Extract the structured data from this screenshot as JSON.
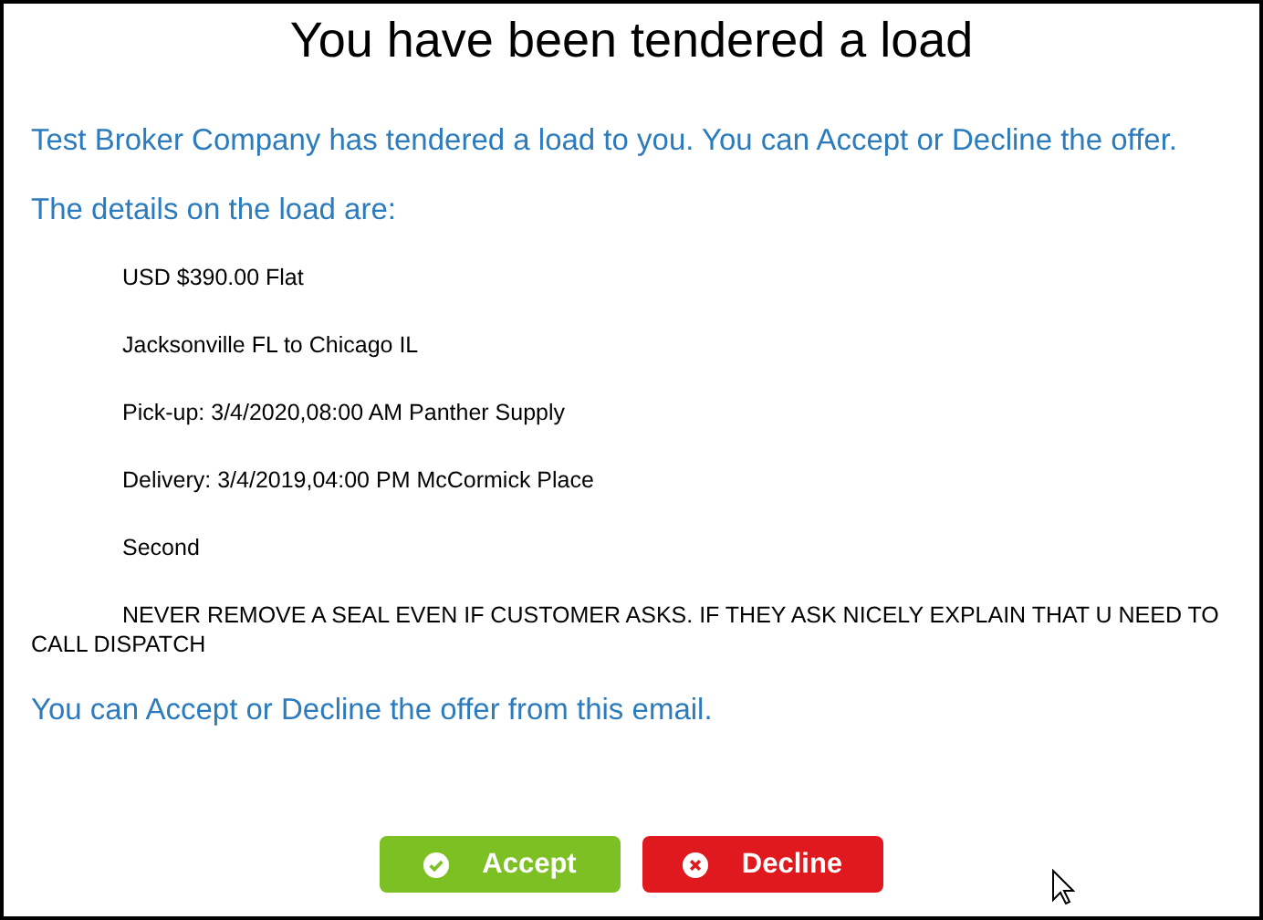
{
  "title": "You have been tendered a load",
  "intro": "Test Broker Company has tendered a load to you. You can Accept or Decline the offer.",
  "details_heading": "The details on the load are:",
  "details": [
    "USD $390.00 Flat",
    "Jacksonville FL to Chicago IL",
    "Pick-up: 3/4/2020,08:00 AM Panther Supply",
    "Delivery: 3/4/2019,04:00 PM McCormick Place",
    "Second",
    "NEVER REMOVE A SEAL EVEN IF CUSTOMER ASKS. IF THEY ASK NICELY EXPLAIN THAT U NEED TO CALL DISPATCH"
  ],
  "footer": "You can Accept or Decline the offer from this email.",
  "buttons": [
    {
      "label": "Accept",
      "kind": "accept"
    },
    {
      "label": "Decline",
      "kind": "decline"
    }
  ]
}
